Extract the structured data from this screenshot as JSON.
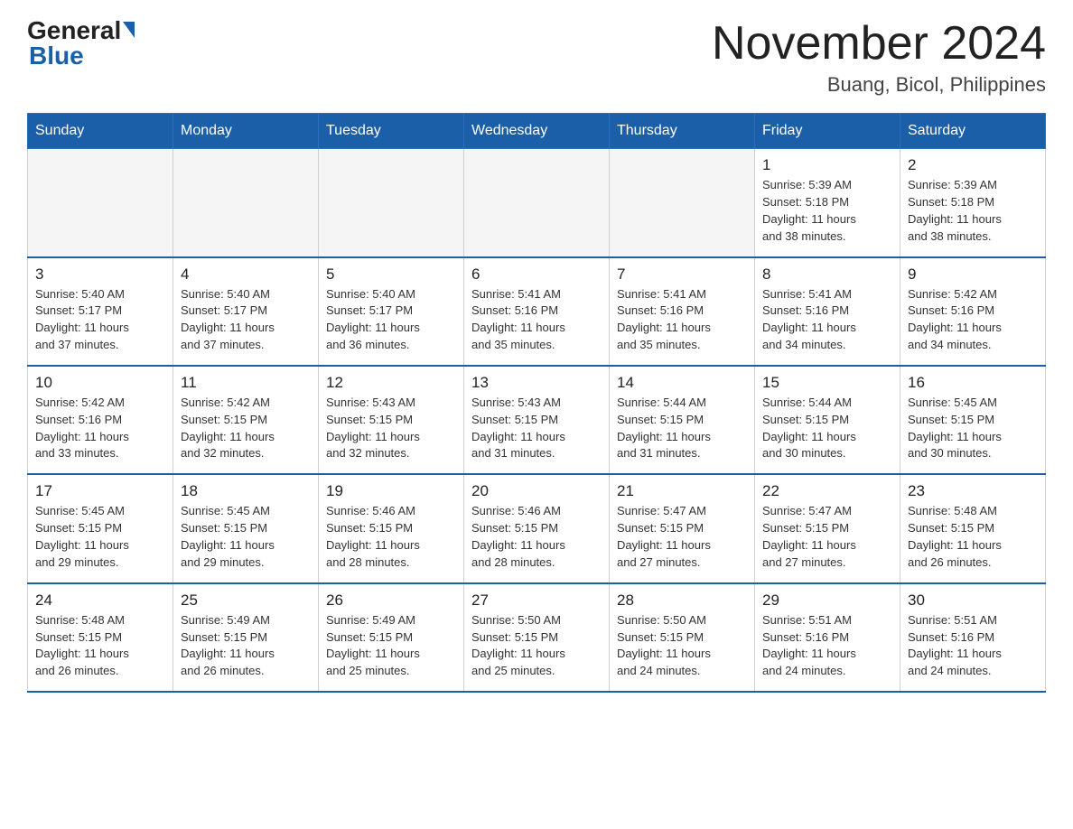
{
  "header": {
    "logo": {
      "general": "General",
      "blue": "Blue"
    },
    "title": "November 2024",
    "subtitle": "Buang, Bicol, Philippines"
  },
  "weekdays": [
    "Sunday",
    "Monday",
    "Tuesday",
    "Wednesday",
    "Thursday",
    "Friday",
    "Saturday"
  ],
  "weeks": [
    [
      {
        "day": "",
        "info": "",
        "empty": true
      },
      {
        "day": "",
        "info": "",
        "empty": true
      },
      {
        "day": "",
        "info": "",
        "empty": true
      },
      {
        "day": "",
        "info": "",
        "empty": true
      },
      {
        "day": "",
        "info": "",
        "empty": true
      },
      {
        "day": "1",
        "info": "Sunrise: 5:39 AM\nSunset: 5:18 PM\nDaylight: 11 hours\nand 38 minutes.",
        "empty": false
      },
      {
        "day": "2",
        "info": "Sunrise: 5:39 AM\nSunset: 5:18 PM\nDaylight: 11 hours\nand 38 minutes.",
        "empty": false
      }
    ],
    [
      {
        "day": "3",
        "info": "Sunrise: 5:40 AM\nSunset: 5:17 PM\nDaylight: 11 hours\nand 37 minutes.",
        "empty": false
      },
      {
        "day": "4",
        "info": "Sunrise: 5:40 AM\nSunset: 5:17 PM\nDaylight: 11 hours\nand 37 minutes.",
        "empty": false
      },
      {
        "day": "5",
        "info": "Sunrise: 5:40 AM\nSunset: 5:17 PM\nDaylight: 11 hours\nand 36 minutes.",
        "empty": false
      },
      {
        "day": "6",
        "info": "Sunrise: 5:41 AM\nSunset: 5:16 PM\nDaylight: 11 hours\nand 35 minutes.",
        "empty": false
      },
      {
        "day": "7",
        "info": "Sunrise: 5:41 AM\nSunset: 5:16 PM\nDaylight: 11 hours\nand 35 minutes.",
        "empty": false
      },
      {
        "day": "8",
        "info": "Sunrise: 5:41 AM\nSunset: 5:16 PM\nDaylight: 11 hours\nand 34 minutes.",
        "empty": false
      },
      {
        "day": "9",
        "info": "Sunrise: 5:42 AM\nSunset: 5:16 PM\nDaylight: 11 hours\nand 34 minutes.",
        "empty": false
      }
    ],
    [
      {
        "day": "10",
        "info": "Sunrise: 5:42 AM\nSunset: 5:16 PM\nDaylight: 11 hours\nand 33 minutes.",
        "empty": false
      },
      {
        "day": "11",
        "info": "Sunrise: 5:42 AM\nSunset: 5:15 PM\nDaylight: 11 hours\nand 32 minutes.",
        "empty": false
      },
      {
        "day": "12",
        "info": "Sunrise: 5:43 AM\nSunset: 5:15 PM\nDaylight: 11 hours\nand 32 minutes.",
        "empty": false
      },
      {
        "day": "13",
        "info": "Sunrise: 5:43 AM\nSunset: 5:15 PM\nDaylight: 11 hours\nand 31 minutes.",
        "empty": false
      },
      {
        "day": "14",
        "info": "Sunrise: 5:44 AM\nSunset: 5:15 PM\nDaylight: 11 hours\nand 31 minutes.",
        "empty": false
      },
      {
        "day": "15",
        "info": "Sunrise: 5:44 AM\nSunset: 5:15 PM\nDaylight: 11 hours\nand 30 minutes.",
        "empty": false
      },
      {
        "day": "16",
        "info": "Sunrise: 5:45 AM\nSunset: 5:15 PM\nDaylight: 11 hours\nand 30 minutes.",
        "empty": false
      }
    ],
    [
      {
        "day": "17",
        "info": "Sunrise: 5:45 AM\nSunset: 5:15 PM\nDaylight: 11 hours\nand 29 minutes.",
        "empty": false
      },
      {
        "day": "18",
        "info": "Sunrise: 5:45 AM\nSunset: 5:15 PM\nDaylight: 11 hours\nand 29 minutes.",
        "empty": false
      },
      {
        "day": "19",
        "info": "Sunrise: 5:46 AM\nSunset: 5:15 PM\nDaylight: 11 hours\nand 28 minutes.",
        "empty": false
      },
      {
        "day": "20",
        "info": "Sunrise: 5:46 AM\nSunset: 5:15 PM\nDaylight: 11 hours\nand 28 minutes.",
        "empty": false
      },
      {
        "day": "21",
        "info": "Sunrise: 5:47 AM\nSunset: 5:15 PM\nDaylight: 11 hours\nand 27 minutes.",
        "empty": false
      },
      {
        "day": "22",
        "info": "Sunrise: 5:47 AM\nSunset: 5:15 PM\nDaylight: 11 hours\nand 27 minutes.",
        "empty": false
      },
      {
        "day": "23",
        "info": "Sunrise: 5:48 AM\nSunset: 5:15 PM\nDaylight: 11 hours\nand 26 minutes.",
        "empty": false
      }
    ],
    [
      {
        "day": "24",
        "info": "Sunrise: 5:48 AM\nSunset: 5:15 PM\nDaylight: 11 hours\nand 26 minutes.",
        "empty": false
      },
      {
        "day": "25",
        "info": "Sunrise: 5:49 AM\nSunset: 5:15 PM\nDaylight: 11 hours\nand 26 minutes.",
        "empty": false
      },
      {
        "day": "26",
        "info": "Sunrise: 5:49 AM\nSunset: 5:15 PM\nDaylight: 11 hours\nand 25 minutes.",
        "empty": false
      },
      {
        "day": "27",
        "info": "Sunrise: 5:50 AM\nSunset: 5:15 PM\nDaylight: 11 hours\nand 25 minutes.",
        "empty": false
      },
      {
        "day": "28",
        "info": "Sunrise: 5:50 AM\nSunset: 5:15 PM\nDaylight: 11 hours\nand 24 minutes.",
        "empty": false
      },
      {
        "day": "29",
        "info": "Sunrise: 5:51 AM\nSunset: 5:16 PM\nDaylight: 11 hours\nand 24 minutes.",
        "empty": false
      },
      {
        "day": "30",
        "info": "Sunrise: 5:51 AM\nSunset: 5:16 PM\nDaylight: 11 hours\nand 24 minutes.",
        "empty": false
      }
    ]
  ]
}
